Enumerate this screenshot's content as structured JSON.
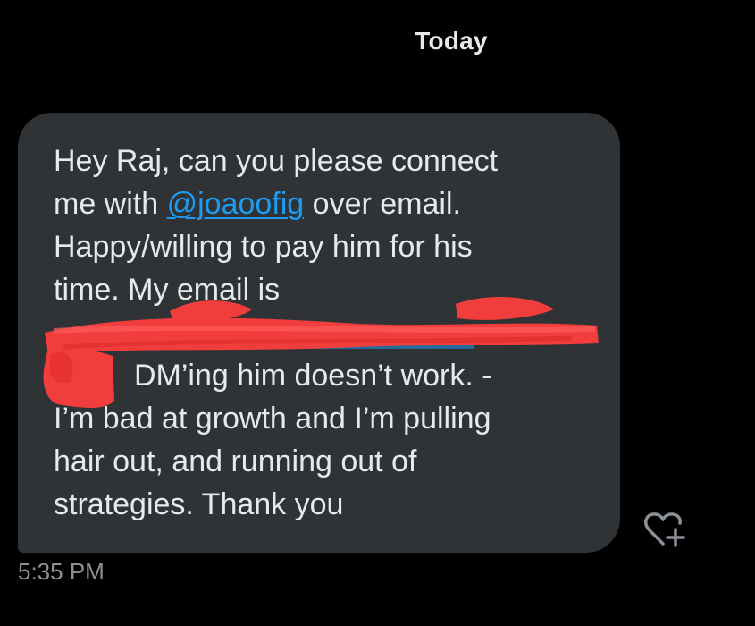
{
  "header": {
    "date_label": "Today"
  },
  "message": {
    "line_1": "Hey Raj, can you please connect",
    "line_2_prefix": "me with ",
    "mention": "@joaoofig",
    "line_2_suffix": " over email.",
    "line_3": "Happy/willing to pay him for his",
    "line_4": "time. My email is",
    "line_6": "DM’ing him doesn’t work. -",
    "line_7": "I’m bad at growth and I’m pulling",
    "line_8": "hair out, and running out of",
    "line_9": "strategies. Thank you",
    "timestamp": "5:35 PM"
  },
  "actions": {
    "react_icon": "heart-plus-icon"
  },
  "colors": {
    "background": "#000000",
    "bubble": "#2f3336",
    "text": "#e7e9ea",
    "mention": "#1d9bf0",
    "redaction": "#f23d3d",
    "timestamp": "#8b9096"
  }
}
